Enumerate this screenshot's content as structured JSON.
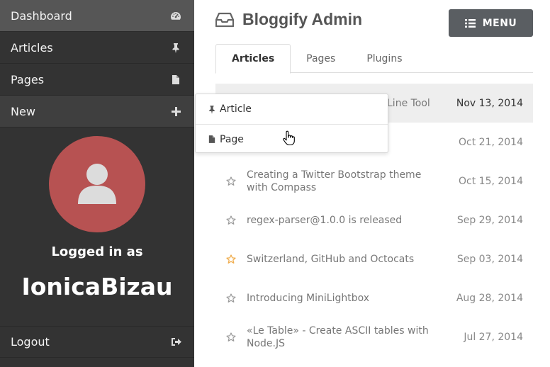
{
  "sidebar": {
    "items": [
      {
        "label": "Dashboard",
        "icon": "dashboard-icon"
      },
      {
        "label": "Articles",
        "icon": "pin-icon"
      },
      {
        "label": "Pages",
        "icon": "file-icon"
      },
      {
        "label": "New",
        "icon": "plus-icon"
      }
    ],
    "logged_in_label": "Logged in as",
    "username": "IonicaBizau",
    "logout": {
      "label": "Logout",
      "icon": "sign-out-icon"
    }
  },
  "header": {
    "title": "Bloggify Admin",
    "menu_label": "MENU"
  },
  "tabs": [
    "Articles",
    "Pages",
    "Plugins"
  ],
  "dropdown": {
    "items": [
      {
        "label": "Article",
        "icon": "pin-icon"
      },
      {
        "label": "Page",
        "icon": "file-icon"
      }
    ]
  },
  "articles": [
    {
      "title": "Line Tool",
      "date": "Nov 13, 2014",
      "starred": false
    },
    {
      "title": "",
      "date": "Oct 21, 2014",
      "starred": false
    },
    {
      "title": "Creating a Twitter Bootstrap theme with Compass",
      "date": "Oct 15, 2014",
      "starred": false
    },
    {
      "title": "regex-parser@1.0.0 is released",
      "date": "Sep 29, 2014",
      "starred": false
    },
    {
      "title": "Switzerland, GitHub and Octocats",
      "date": "Sep 03, 2014",
      "starred": true
    },
    {
      "title": "Introducing MiniLightbox",
      "date": "Aug 28, 2014",
      "starred": false
    },
    {
      "title": "«Le Table» - Create ASCII tables with Node.JS",
      "date": "Jul 27, 2014",
      "starred": false
    }
  ],
  "colors": {
    "sidebar_bg": "#333333",
    "avatar_bg": "#b75252",
    "menu_button_bg": "#5a5e62",
    "star_active": "#f0ad4e"
  }
}
